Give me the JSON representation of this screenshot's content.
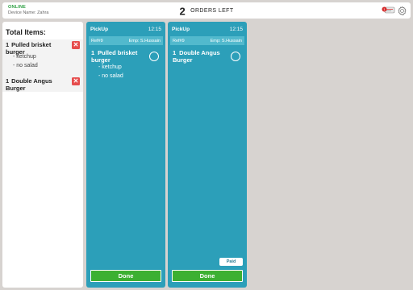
{
  "header": {
    "status": "ONLINE",
    "device": "Device Name: Zahra",
    "orders_count": "2",
    "orders_label": "ORDERS LEFT"
  },
  "sidebar": {
    "title": "Total Items:",
    "items": [
      {
        "qty": "1",
        "name": "Pulled brisket burger",
        "modifiers": [
          "- ketchup",
          "- no salad"
        ],
        "remove": "✕"
      },
      {
        "qty": "1",
        "name": "Double Angus Burger",
        "modifiers": [],
        "remove": "✕"
      }
    ]
  },
  "tickets": [
    {
      "type": "PickUp",
      "time": "12:15",
      "ref": "Ref#9",
      "emp": "Emp: S.Hussain",
      "item": {
        "qty": "1",
        "name": "Pulled brisket burger",
        "modifiers": [
          "- ketchup",
          "- no salad"
        ]
      },
      "done": "Done"
    },
    {
      "type": "PickUp",
      "time": "12:15",
      "ref": "Ref#9",
      "emp": "Emp: S.Hussain",
      "item": {
        "qty": "1",
        "name": "Double Angus Burger",
        "modifiers": []
      },
      "paid": "Paid",
      "done": "Done"
    }
  ],
  "colors": {
    "online": "#2ea043",
    "ticket": "#2c9fb9",
    "ticket_sub": "#52b9cd",
    "done": "#3cb032",
    "remove": "#e64c4c",
    "background": "#d7d3d0"
  },
  "icons": {
    "messages": "message-bubbles-icon",
    "settings": "gear-icon"
  }
}
